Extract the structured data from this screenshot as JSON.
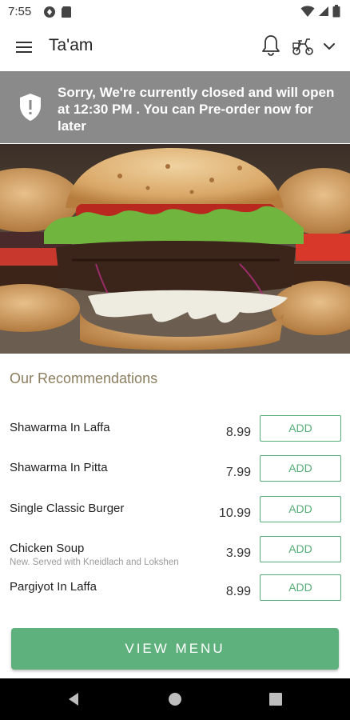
{
  "status_bar": {
    "time": "7:55"
  },
  "app_bar": {
    "title": "Ta'am"
  },
  "closed_banner": {
    "message": "Sorry, We're currently closed and will open at 12:30 PM . You can Pre-order now for later"
  },
  "recommendations": {
    "title": "Our Recommendations",
    "items": [
      {
        "name": "Shawarma In Laffa",
        "description": "",
        "price": "8.99",
        "add_label": "ADD"
      },
      {
        "name": "Shawarma In Pitta",
        "description": "",
        "price": "7.99",
        "add_label": "ADD"
      },
      {
        "name": "Single Classic Burger",
        "description": "",
        "price": "10.99",
        "add_label": "ADD"
      },
      {
        "name": "Chicken Soup",
        "description": "New. Served with Kneidlach and Lokshen",
        "price": "3.99",
        "add_label": "ADD"
      },
      {
        "name": "Pargiyot In Laffa",
        "description": "",
        "price": "8.99",
        "add_label": "ADD"
      }
    ]
  },
  "view_menu_label": "VIEW MENU",
  "colors": {
    "accent_green": "#5eb07c",
    "banner_gray": "#8a8a8a",
    "heading_olive": "#8c7e5e"
  }
}
